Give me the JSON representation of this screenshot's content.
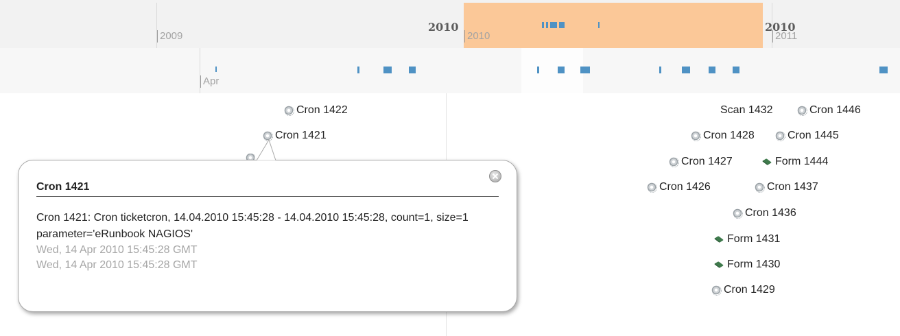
{
  "overview": {
    "tick_labels": [
      "2009",
      "2010",
      "2011"
    ],
    "bold_years": [
      "2010",
      "2010"
    ]
  },
  "detail": {
    "tick_labels": [
      "Apr"
    ]
  },
  "events": [
    {
      "id": "cron-1422",
      "label": "Cron 1422",
      "icon": "gear-icon"
    },
    {
      "id": "cron-1421",
      "label": "Cron 1421",
      "icon": "gear-icon"
    },
    {
      "id": "scan-1432",
      "label": "Scan 1432",
      "icon": ""
    },
    {
      "id": "cron-1446",
      "label": "Cron 1446",
      "icon": "gear-icon"
    },
    {
      "id": "cron-1428",
      "label": "Cron 1428",
      "icon": "gear-icon"
    },
    {
      "id": "cron-1445",
      "label": "Cron 1445",
      "icon": "gear-icon"
    },
    {
      "id": "cron-1427",
      "label": "Cron 1427",
      "icon": "gear-icon"
    },
    {
      "id": "form-1444",
      "label": "Form 1444",
      "icon": "form-icon"
    },
    {
      "id": "cron-1426",
      "label": "Cron 1426",
      "icon": "gear-icon"
    },
    {
      "id": "cron-1437",
      "label": "Cron 1437",
      "icon": "gear-icon"
    },
    {
      "id": "cron-1436",
      "label": "Cron 1436",
      "icon": "gear-icon"
    },
    {
      "id": "form-1431",
      "label": "Form 1431",
      "icon": "form-icon"
    },
    {
      "id": "form-1430",
      "label": "Form 1430",
      "icon": "form-icon"
    },
    {
      "id": "cron-1429",
      "label": "Cron 1429",
      "icon": "gear-icon"
    }
  ],
  "bubble": {
    "title": "Cron 1421",
    "description": "Cron 1421: Cron ticketcron, 14.04.2010 15:45:28 - 14.04.2010 15:45:28, count=1, size=1 parameter='eRunbook NAGIOS'",
    "start_date": "Wed, 14 Apr 2010 15:45:28 GMT",
    "end_date": "Wed, 14 Apr 2010 15:45:28 GMT"
  },
  "colors": {
    "highlight_window": "#fbc898",
    "event_marker": "#4f92c4",
    "form_icon": "#3f7a4c"
  }
}
